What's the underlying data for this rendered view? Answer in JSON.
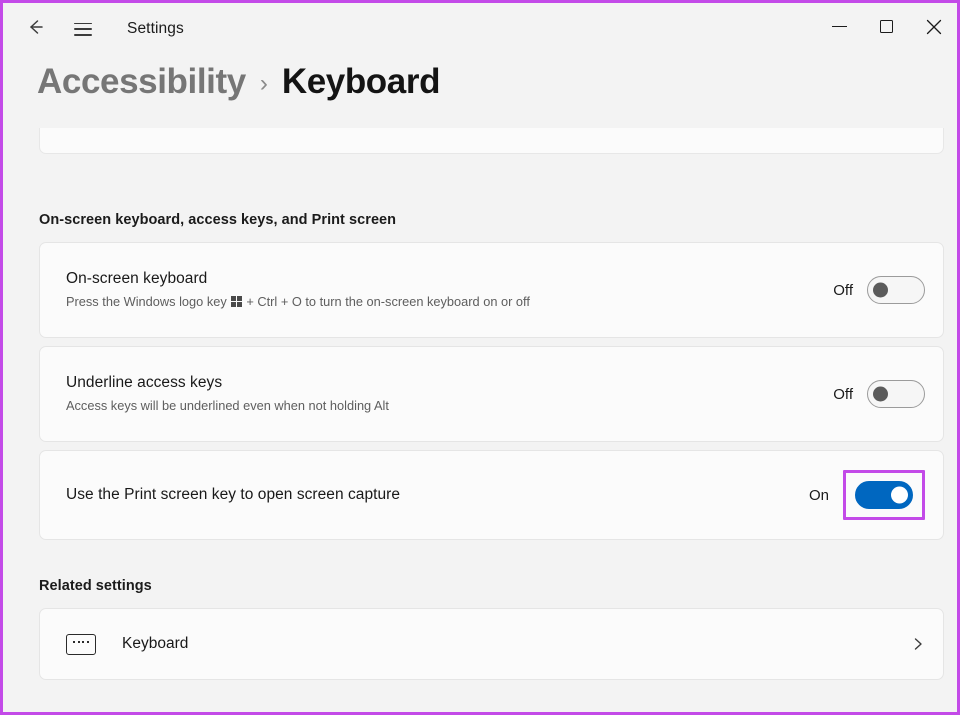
{
  "window": {
    "title": "Settings",
    "back_icon": "back-arrow-icon",
    "menu_icon": "hamburger-menu-icon",
    "minimize_label": "Minimize",
    "maximize_label": "Maximize",
    "close_label": "Close"
  },
  "breadcrumb": {
    "parent": "Accessibility",
    "separator": "›",
    "current": "Keyboard"
  },
  "sections": {
    "main_heading": "On-screen keyboard, access keys, and Print screen",
    "related_heading": "Related settings"
  },
  "settings": [
    {
      "title": "On-screen keyboard",
      "desc_before": "Press the Windows logo key",
      "desc_after": "+ Ctrl + O to turn the on-screen keyboard on or off",
      "state_label": "Off",
      "state": "off",
      "highlighted": false
    },
    {
      "title": "Underline access keys",
      "desc_before": "Access keys will be underlined even when not holding Alt",
      "desc_after": "",
      "state_label": "Off",
      "state": "off",
      "highlighted": false
    },
    {
      "title": "Use the Print screen key to open screen capture",
      "desc_before": "",
      "desc_after": "",
      "state_label": "On",
      "state": "on",
      "highlighted": true
    }
  ],
  "related": {
    "label": "Keyboard",
    "icon": "keyboard-icon",
    "chevron": "chevron-right-icon"
  },
  "colors": {
    "accent_blue": "#0067c0",
    "highlight_magenta": "#c34ae8",
    "page_bg": "#f3f3f3",
    "card_bg": "#fbfbfb"
  }
}
